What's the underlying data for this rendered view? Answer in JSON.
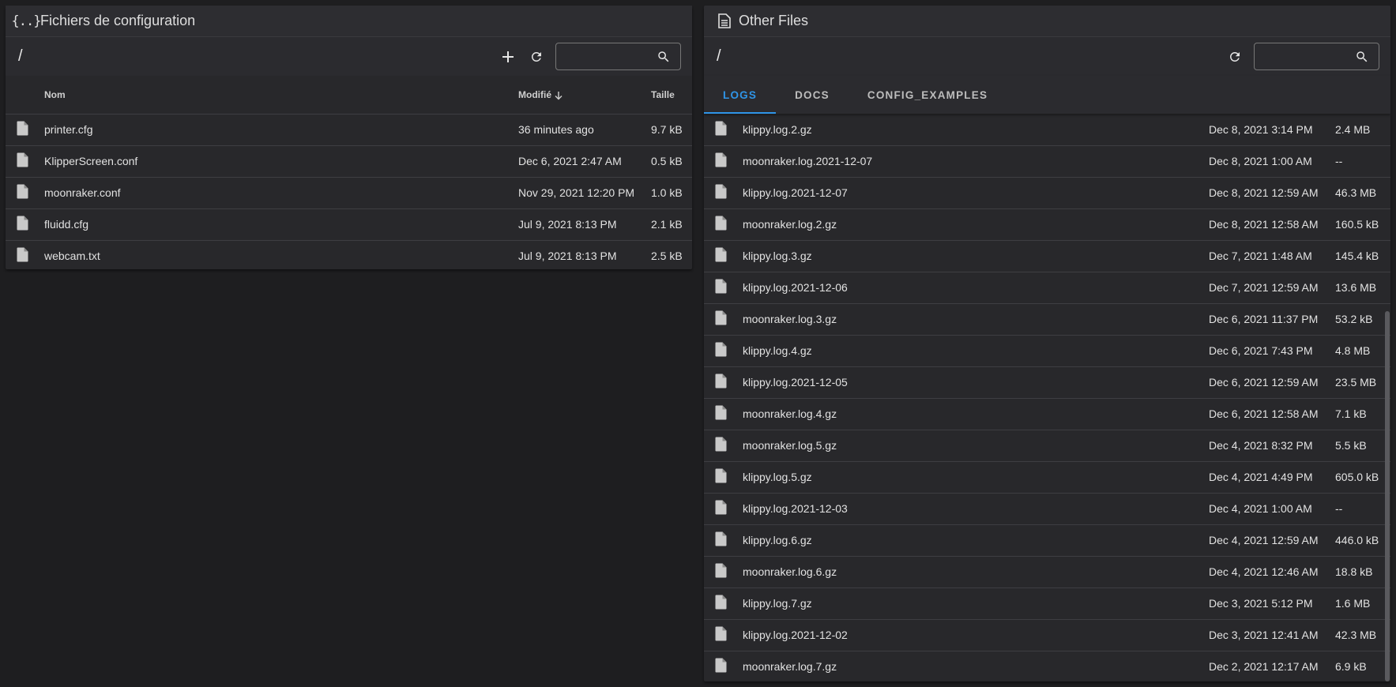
{
  "config_panel": {
    "title": "Fichiers de configuration",
    "title_icon": "braces-icon",
    "path": "/",
    "search": {
      "value": "",
      "placeholder": ""
    },
    "columns": {
      "name": "Nom",
      "modified": "Modifié",
      "size": "Taille"
    },
    "sort": {
      "column": "modified",
      "direction": "descending"
    },
    "files": [
      {
        "name": "printer.cfg",
        "modified": "36 minutes ago",
        "size": "9.7 kB"
      },
      {
        "name": "KlipperScreen.conf",
        "modified": "Dec 6, 2021 2:47 AM",
        "size": "0.5 kB"
      },
      {
        "name": "moonraker.conf",
        "modified": "Nov 29, 2021 12:20 PM",
        "size": "1.0 kB"
      },
      {
        "name": "fluidd.cfg",
        "modified": "Jul 9, 2021 8:13 PM",
        "size": "2.1 kB"
      },
      {
        "name": "webcam.txt",
        "modified": "Jul 9, 2021 8:13 PM",
        "size": "2.5 kB"
      }
    ]
  },
  "other_panel": {
    "title": "Other Files",
    "title_icon": "document-icon",
    "path": "/",
    "search": {
      "value": "",
      "placeholder": ""
    },
    "tabs": [
      {
        "label": "LOGS",
        "active": true
      },
      {
        "label": "DOCS",
        "active": false
      },
      {
        "label": "CONFIG_EXAMPLES",
        "active": false
      }
    ],
    "files": [
      {
        "name": "klippy.log.2.gz",
        "modified": "Dec 8, 2021 3:14 PM",
        "size": "2.4 MB"
      },
      {
        "name": "moonraker.log.2021-12-07",
        "modified": "Dec 8, 2021 1:00 AM",
        "size": "--"
      },
      {
        "name": "klippy.log.2021-12-07",
        "modified": "Dec 8, 2021 12:59 AM",
        "size": "46.3 MB"
      },
      {
        "name": "moonraker.log.2.gz",
        "modified": "Dec 8, 2021 12:58 AM",
        "size": "160.5 kB"
      },
      {
        "name": "klippy.log.3.gz",
        "modified": "Dec 7, 2021 1:48 AM",
        "size": "145.4 kB"
      },
      {
        "name": "klippy.log.2021-12-06",
        "modified": "Dec 7, 2021 12:59 AM",
        "size": "13.6 MB"
      },
      {
        "name": "moonraker.log.3.gz",
        "modified": "Dec 6, 2021 11:37 PM",
        "size": "53.2 kB"
      },
      {
        "name": "klippy.log.4.gz",
        "modified": "Dec 6, 2021 7:43 PM",
        "size": "4.8 MB"
      },
      {
        "name": "klippy.log.2021-12-05",
        "modified": "Dec 6, 2021 12:59 AM",
        "size": "23.5 MB"
      },
      {
        "name": "moonraker.log.4.gz",
        "modified": "Dec 6, 2021 12:58 AM",
        "size": "7.1 kB"
      },
      {
        "name": "moonraker.log.5.gz",
        "modified": "Dec 4, 2021 8:32 PM",
        "size": "5.5 kB"
      },
      {
        "name": "klippy.log.5.gz",
        "modified": "Dec 4, 2021 4:49 PM",
        "size": "605.0 kB"
      },
      {
        "name": "klippy.log.2021-12-03",
        "modified": "Dec 4, 2021 1:00 AM",
        "size": "--"
      },
      {
        "name": "klippy.log.6.gz",
        "modified": "Dec 4, 2021 12:59 AM",
        "size": "446.0 kB"
      },
      {
        "name": "moonraker.log.6.gz",
        "modified": "Dec 4, 2021 12:46 AM",
        "size": "18.8 kB"
      },
      {
        "name": "klippy.log.7.gz",
        "modified": "Dec 3, 2021 5:12 PM",
        "size": "1.6 MB"
      },
      {
        "name": "klippy.log.2021-12-02",
        "modified": "Dec 3, 2021 12:41 AM",
        "size": "42.3 MB"
      },
      {
        "name": "moonraker.log.7.gz",
        "modified": "Dec 2, 2021 12:17 AM",
        "size": "6.9 kB"
      }
    ]
  },
  "colors": {
    "background": "#1e1e20",
    "panel": "#28282b",
    "accent": "#2f95e8",
    "text": "#e2e2e2"
  }
}
